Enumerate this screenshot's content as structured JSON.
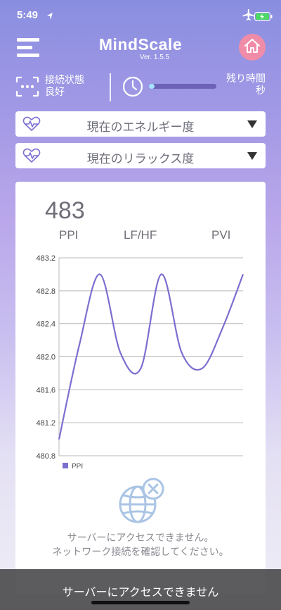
{
  "status_bar": {
    "time": "5:49"
  },
  "header": {
    "app_name": "MindScale",
    "version": "Ver. 1.5.5"
  },
  "connection": {
    "line1": "接続状態",
    "line2": "良好"
  },
  "timer": {
    "line1": "残り時間",
    "line2": "秒",
    "progress": 0.08
  },
  "dropdowns": [
    {
      "label": "現在のエネルギー度"
    },
    {
      "label": "現在のリラックス度"
    }
  ],
  "metric": {
    "value": "483"
  },
  "tabs": [
    "PPI",
    "LF/HF",
    "PVI"
  ],
  "chart_data": {
    "type": "line",
    "series": [
      {
        "name": "PPI",
        "x": [
          0,
          1,
          2,
          3,
          4,
          5,
          6,
          7,
          8,
          9
        ],
        "values": [
          481.0,
          482.15,
          483.0,
          482.05,
          481.86,
          483.0,
          482.05,
          481.86,
          482.35,
          483.0
        ]
      }
    ],
    "ylim": [
      480.8,
      483.2
    ],
    "yticks": [
      "483.2",
      "482.8",
      "482.4",
      "482.0",
      "481.6",
      "481.2",
      "480.8"
    ],
    "grid": true,
    "legend": "bottom-left",
    "color": "#7b6fd0"
  },
  "error": {
    "line1": "サーバーにアクセスできません。",
    "line2": "ネットワーク接続を確認してください。"
  },
  "toast": {
    "text": "サーバーにアクセスできません"
  },
  "colors": {
    "accent": "#7b6fd0",
    "home": "#f08ca8",
    "progress_track": "#6c63b8",
    "progress_fill": "#a5e3ff"
  }
}
